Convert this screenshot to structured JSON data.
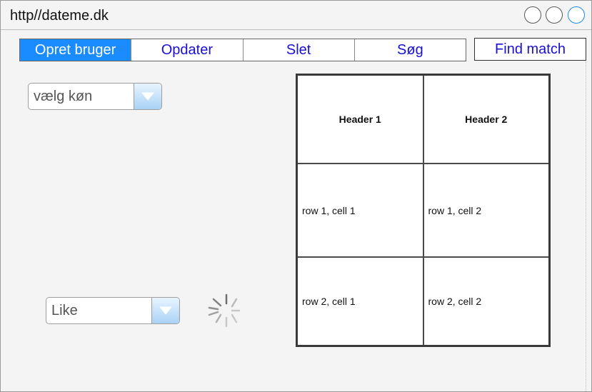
{
  "window": {
    "url": "http//dateme.dk"
  },
  "tabs": [
    {
      "label": "Opret bruger",
      "active": true
    },
    {
      "label": "Opdater",
      "active": false
    },
    {
      "label": "Slet",
      "active": false
    },
    {
      "label": "Søg",
      "active": false
    }
  ],
  "find_match": {
    "label": "Find match"
  },
  "gender_select": {
    "value": "vælg køn"
  },
  "like_select": {
    "value": "Like"
  },
  "table": {
    "headers": [
      "Header 1",
      "Header 2"
    ],
    "rows": [
      [
        "row 1, cell 1",
        "row 1, cell 2"
      ],
      [
        "row 2, cell 1",
        "row 2, cell 2"
      ]
    ]
  },
  "colors": {
    "active_tab": "#1a8cff",
    "link_text": "#1a10d4"
  }
}
